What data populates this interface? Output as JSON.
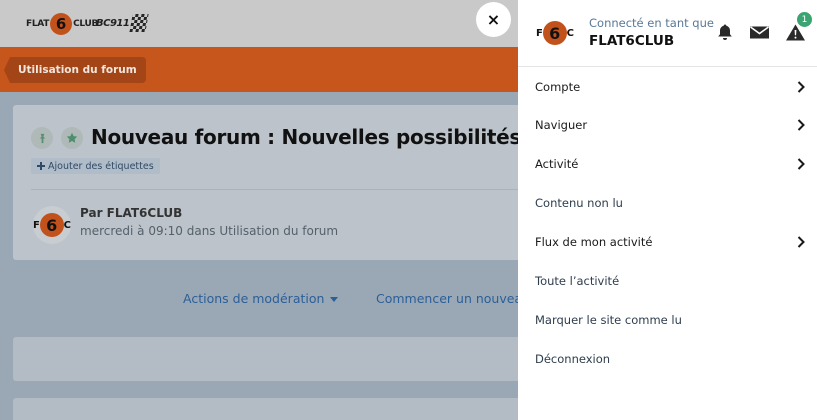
{
  "site": {
    "logo_left": {
      "pre": "FLAT",
      "mid": "6",
      "post": "CLUB"
    },
    "logo_right": "BC911"
  },
  "breadcrumb": {
    "label": "Utilisation du forum"
  },
  "thread": {
    "title": "Nouveau forum : Nouvelles possibilités",
    "add_tags": "Ajouter des étiquettes",
    "author_line": "Par FLAT6CLUB",
    "meta": "mercredi à 09:10 dans Utilisation du forum"
  },
  "actions": {
    "moderation": "Actions de modération",
    "start": "Commencer un nouveau"
  },
  "avatar": {
    "left": "F",
    "mid": "6",
    "right": "C"
  },
  "account": {
    "connected_as": "Connecté en tant que",
    "username": "FLAT6CLUB",
    "alerts_count": "1"
  },
  "menu": {
    "items": [
      {
        "label": "Compte",
        "has_submenu": true
      },
      {
        "label": "Naviguer",
        "has_submenu": true
      },
      {
        "label": "Activité",
        "has_submenu": true
      },
      {
        "label": "Contenu non lu",
        "has_submenu": false
      },
      {
        "label": "Flux de mon activité",
        "has_submenu": true
      },
      {
        "label": "Toute l’activité",
        "has_submenu": false
      },
      {
        "label": "Marquer le site comme lu",
        "has_submenu": false
      },
      {
        "label": "Déconnexion",
        "has_submenu": false
      }
    ]
  },
  "close_symbol": "×",
  "colors": {
    "brand_orange": "#c6561c",
    "link_blue": "#2b5f98",
    "badge_green": "#3aa573"
  }
}
